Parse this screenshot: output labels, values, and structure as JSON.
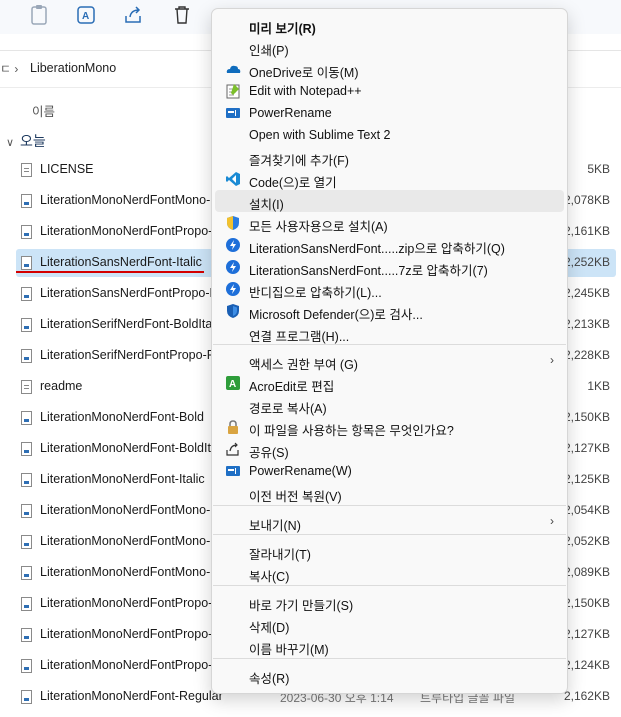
{
  "explorer": {
    "path": {
      "sep": "ㄷ ›",
      "folder": "LiberationMono"
    },
    "column_name": "이름",
    "group_label": "오늘",
    "files": [
      {
        "name": "LICENSE",
        "size": "5KB",
        "icon": "doc"
      },
      {
        "name": "LiterationMonoNerdFontMono-",
        "size": "2,078KB",
        "icon": "font"
      },
      {
        "name": "LiterationMonoNerdFontPropo-",
        "size": "2,161KB",
        "icon": "font"
      },
      {
        "name": "LiterationSansNerdFont-Italic",
        "size": "2,252KB",
        "icon": "font"
      },
      {
        "name": "LiterationSansNerdFontPropo-Re",
        "size": "2,245KB",
        "icon": "font"
      },
      {
        "name": "LiterationSerifNerdFont-BoldItali",
        "size": "2,213KB",
        "icon": "font"
      },
      {
        "name": "LiterationSerifNerdFontPropo-Re",
        "size": "2,228KB",
        "icon": "font"
      },
      {
        "name": "readme",
        "size": "1KB",
        "icon": "doc"
      },
      {
        "name": "LiterationMonoNerdFont-Bold",
        "size": "2,150KB",
        "icon": "font"
      },
      {
        "name": "LiterationMonoNerdFont-BoldIta",
        "size": "2,127KB",
        "icon": "font"
      },
      {
        "name": "LiterationMonoNerdFont-Italic",
        "size": "2,125KB",
        "icon": "font"
      },
      {
        "name": "LiterationMonoNerdFontMono-I",
        "size": "2,054KB",
        "icon": "font"
      },
      {
        "name": "LiterationMonoNerdFontMono-I",
        "size": "2,052KB",
        "icon": "font"
      },
      {
        "name": "LiterationMonoNerdFontMono-I",
        "size": "2,089KB",
        "icon": "font"
      },
      {
        "name": "LiterationMonoNerdFontPropo-I",
        "size": "2,150KB",
        "icon": "font"
      },
      {
        "name": "LiterationMonoNerdFontPropo-I",
        "size": "2,127KB",
        "icon": "font"
      },
      {
        "name": "LiterationMonoNerdFontPropo-I",
        "size": "2,124KB",
        "icon": "font"
      },
      {
        "name": "LiterationMonoNerdFont-Regular",
        "size": "2,162KB",
        "icon": "font",
        "date": "2023-06-30 오후 1:14",
        "type": "트루타입 글꼴 파일"
      }
    ],
    "selected_index": 3
  },
  "context_menu": {
    "items": [
      {
        "label": "미리 보기(R)",
        "icon": "",
        "bold": true
      },
      {
        "label": "인쇄(P)",
        "icon": ""
      },
      {
        "label": "OneDrive로 이동(M)",
        "icon": "onedrive-icon"
      },
      {
        "label": "Edit with Notepad++",
        "icon": "notepadpp-icon"
      },
      {
        "label": "PowerRename",
        "icon": "powerrename-icon"
      },
      {
        "label": "Open with Sublime Text 2",
        "icon": ""
      },
      {
        "label": "즐겨찾기에 추가(F)",
        "icon": ""
      },
      {
        "label": "Code(으)로 열기",
        "icon": "vscode-icon"
      },
      {
        "label": "설치(I)",
        "icon": "",
        "hover": true
      },
      {
        "label": "모든 사용자용으로 설치(A)",
        "icon": "uac-shield-icon"
      },
      {
        "label": "LiterationSansNerdFont.....zip으로 압축하기(Q)",
        "icon": "bandizip-icon"
      },
      {
        "label": "LiterationSansNerdFont.....7z로 압축하기(7)",
        "icon": "bandizip-icon"
      },
      {
        "label": "반디집으로 압축하기(L)...",
        "icon": "bandizip-icon"
      },
      {
        "label": "Microsoft Defender(으)로 검사...",
        "icon": "defender-icon"
      },
      {
        "label": "연결 프로그램(H)...",
        "icon": ""
      },
      {
        "label": "액세스 권한 부여 (G)",
        "icon": "",
        "submenu": true
      },
      {
        "label": "AcroEdit로 편집",
        "icon": "acroedit-icon"
      },
      {
        "label": "경로로 복사(A)",
        "icon": ""
      },
      {
        "label": "이 파일을 사용하는 항목은 무엇인가요?",
        "icon": "lock-icon"
      },
      {
        "label": "공유(S)",
        "icon": "share-icon"
      },
      {
        "label": "PowerRename(W)",
        "icon": "powerrename-icon"
      },
      {
        "label": "이전 버전 복원(V)",
        "icon": ""
      },
      {
        "label": "보내기(N)",
        "icon": "",
        "submenu": true
      },
      {
        "label": "잘라내기(T)",
        "icon": ""
      },
      {
        "label": "복사(C)",
        "icon": ""
      },
      {
        "label": "바로 가기 만들기(S)",
        "icon": ""
      },
      {
        "label": "삭제(D)",
        "icon": ""
      },
      {
        "label": "이름 바꾸기(M)",
        "icon": ""
      },
      {
        "label": "속성(R)",
        "icon": ""
      }
    ],
    "submenu_arrow": "›"
  },
  "colors": {
    "selection": "#cce4f7",
    "annotation_red": "#d40000",
    "menu_bg": "#f9f9f9"
  }
}
